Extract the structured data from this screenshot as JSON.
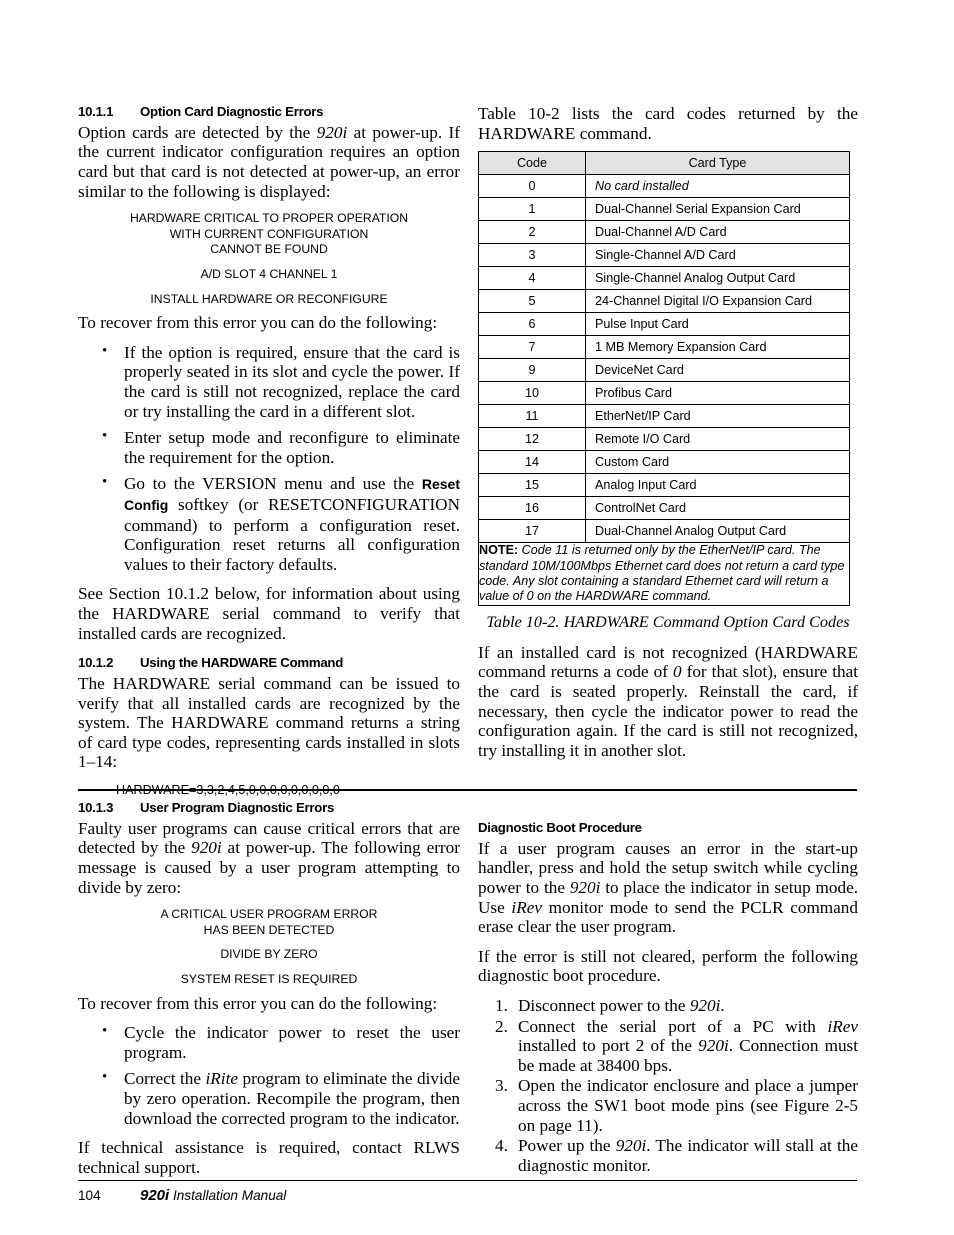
{
  "page": {
    "footer_page_number": "104",
    "footer_title_bold": "920i",
    "footer_title_rest": " Installation Manual"
  },
  "left_column": {
    "section_10_1_1": {
      "number": "10.1.1",
      "title": "Option Card Diagnostic Errors",
      "intro_p1_a": "Option cards are detected by the ",
      "intro_p1_italic": "920i",
      "intro_p1_b": " at power-up. If the current indicator configuration requires an option card but that card is not detected at power-up, an error similar to the following is displayed:",
      "message_lines_group1": [
        "HARDWARE CRITICAL TO PROPER OPERATION",
        "WITH CURRENT CONFIGURATION",
        "CANNOT BE FOUND"
      ],
      "message_lines_group2": [
        "A/D SLOT 4 CHANNEL 1"
      ],
      "message_lines_group3": [
        "INSTALL HARDWARE OR RECONFIGURE"
      ],
      "recover_lead": "To recover from this error you can do the following:",
      "bullets": [
        "If the option is required, ensure that the card is properly seated in its slot and cycle the power. If the card is still not recognized, replace the card or try installing the card in a different slot.",
        "Enter setup mode and reconfigure to eliminate the requirement for the option."
      ],
      "bullet3_a": "Go to the VERSION menu and use the ",
      "bullet3_softkey": "Reset Config",
      "bullet3_b": " softkey (or RESETCONFIGURATION command) to perform a configuration reset. Configuration reset returns all configuration values to their factory defaults.",
      "see_section": "See Section 10.1.2 below, for information about using the HARDWARE serial command to verify that installed cards are recognized."
    },
    "section_10_1_2": {
      "number": "10.1.2",
      "title": "Using the HARDWARE Command",
      "paragraph": "The HARDWARE serial command can be issued to verify that all installed cards are recognized by the system. The HARDWARE command returns a string of card type codes, representing cards installed in slots 1–14:",
      "code_example": "HARDWARE=3,3,2,4,5,0,0,0,0,0,0,0,0,0"
    },
    "section_10_1_3": {
      "number": "10.1.3",
      "title": "User Program Diagnostic Errors",
      "intro_a": "Faulty user programs can cause critical errors that are detected by the ",
      "intro_italic": "920i",
      "intro_b": " at power-up. The following error message is caused by a user program attempting to divide by zero:",
      "message_lines_group1": [
        "A CRITICAL USER PROGRAM ERROR",
        "HAS BEEN DETECTED"
      ],
      "message_lines_group2": [
        "DIVIDE BY ZERO"
      ],
      "message_lines_group3": [
        "SYSTEM RESET IS REQUIRED"
      ],
      "recover_lead": "To recover from this error you can do the following:",
      "bullet1": "Cycle the indicator power to reset the user program.",
      "bullet2_a": "Correct the ",
      "bullet2_italic": "iRite",
      "bullet2_b": " program to eliminate the divide by zero operation. Recompile the program, then download the corrected program to the indicator.",
      "closing": "If technical assistance is required, contact RLWS technical support."
    }
  },
  "right_column": {
    "table_intro": "Table 10-2 lists the card codes returned by the HARDWARE command.",
    "table": {
      "headers": [
        "Code",
        "Card Type"
      ],
      "rows": [
        {
          "code": "0",
          "type": "No card installed",
          "italic": true
        },
        {
          "code": "1",
          "type": "Dual-Channel Serial Expansion Card",
          "italic": false
        },
        {
          "code": "2",
          "type": "Dual-Channel A/D Card",
          "italic": false
        },
        {
          "code": "3",
          "type": "Single-Channel A/D Card",
          "italic": false
        },
        {
          "code": "4",
          "type": "Single-Channel Analog Output Card",
          "italic": false
        },
        {
          "code": "5",
          "type": "24-Channel Digital I/O Expansion Card",
          "italic": false
        },
        {
          "code": "6",
          "type": "Pulse Input Card",
          "italic": false
        },
        {
          "code": "7",
          "type": "1 MB Memory Expansion Card",
          "italic": false
        },
        {
          "code": "9",
          "type": "DeviceNet Card",
          "italic": false
        },
        {
          "code": "10",
          "type": "Profibus Card",
          "italic": false
        },
        {
          "code": "11",
          "type": "EtherNet/IP Card",
          "italic": false
        },
        {
          "code": "12",
          "type": "Remote I/O Card",
          "italic": false
        },
        {
          "code": "14",
          "type": "Custom Card",
          "italic": false
        },
        {
          "code": "15",
          "type": "Analog Input Card",
          "italic": false
        },
        {
          "code": "16",
          "type": "ControlNet Card",
          "italic": false
        },
        {
          "code": "17",
          "type": "Dual-Channel Analog Output Card",
          "italic": false
        }
      ],
      "note_label": "NOTE:",
      "note_text": " Code 11 is returned only by the EtherNet/IP card. The standard 10M/100Mbps Ethernet card does not return a card type code. Any slot containing a standard Ethernet card will return a value of 0 on the HARDWARE command.",
      "caption": "Table 10-2. HARDWARE Command Option Card Codes"
    },
    "after_table_paragraph_a": "If an installed card is not recognized (HARDWARE command returns a code of ",
    "after_table_paragraph_italic": "0",
    "after_table_paragraph_b": " for that slot), ensure that the card is seated properly. Reinstall the card, if necessary, then cycle the indicator power to read the configuration again. If the card is still not recognized, try installing it in another slot.",
    "boot_procedure": {
      "title": "Diagnostic Boot Procedure",
      "p1_a": "If a user program causes an error in the start-up handler, press and hold the setup switch while cycling power to the ",
      "p1_italic1": "920i",
      "p1_b": " to place the indicator in setup mode. Use ",
      "p1_italic2": "iRev",
      "p1_c": " monitor mode to send the PCLR command erase clear the user program.",
      "p2": "If the error is still not cleared, perform the following diagnostic boot procedure.",
      "step1_a": "Disconnect power to the ",
      "step1_italic": "920i",
      "step1_b": ".",
      "step2_a": "Connect the serial port of a PC with ",
      "step2_italic1": "iRev",
      "step2_b": " installed to port 2 of the ",
      "step2_italic2": "920i",
      "step2_c": ". Connection must be made at 38400 bps.",
      "step3": "Open the indicator enclosure and place a jumper across the SW1 boot mode pins (see Figure 2-5 on page 11).",
      "step4_a": "Power up the ",
      "step4_italic": "920i",
      "step4_b": ". The indicator will stall at the diagnostic monitor."
    }
  },
  "colors": {
    "table_header_bg": "#e3e3e3",
    "border": "#000000",
    "text": "#000000"
  }
}
